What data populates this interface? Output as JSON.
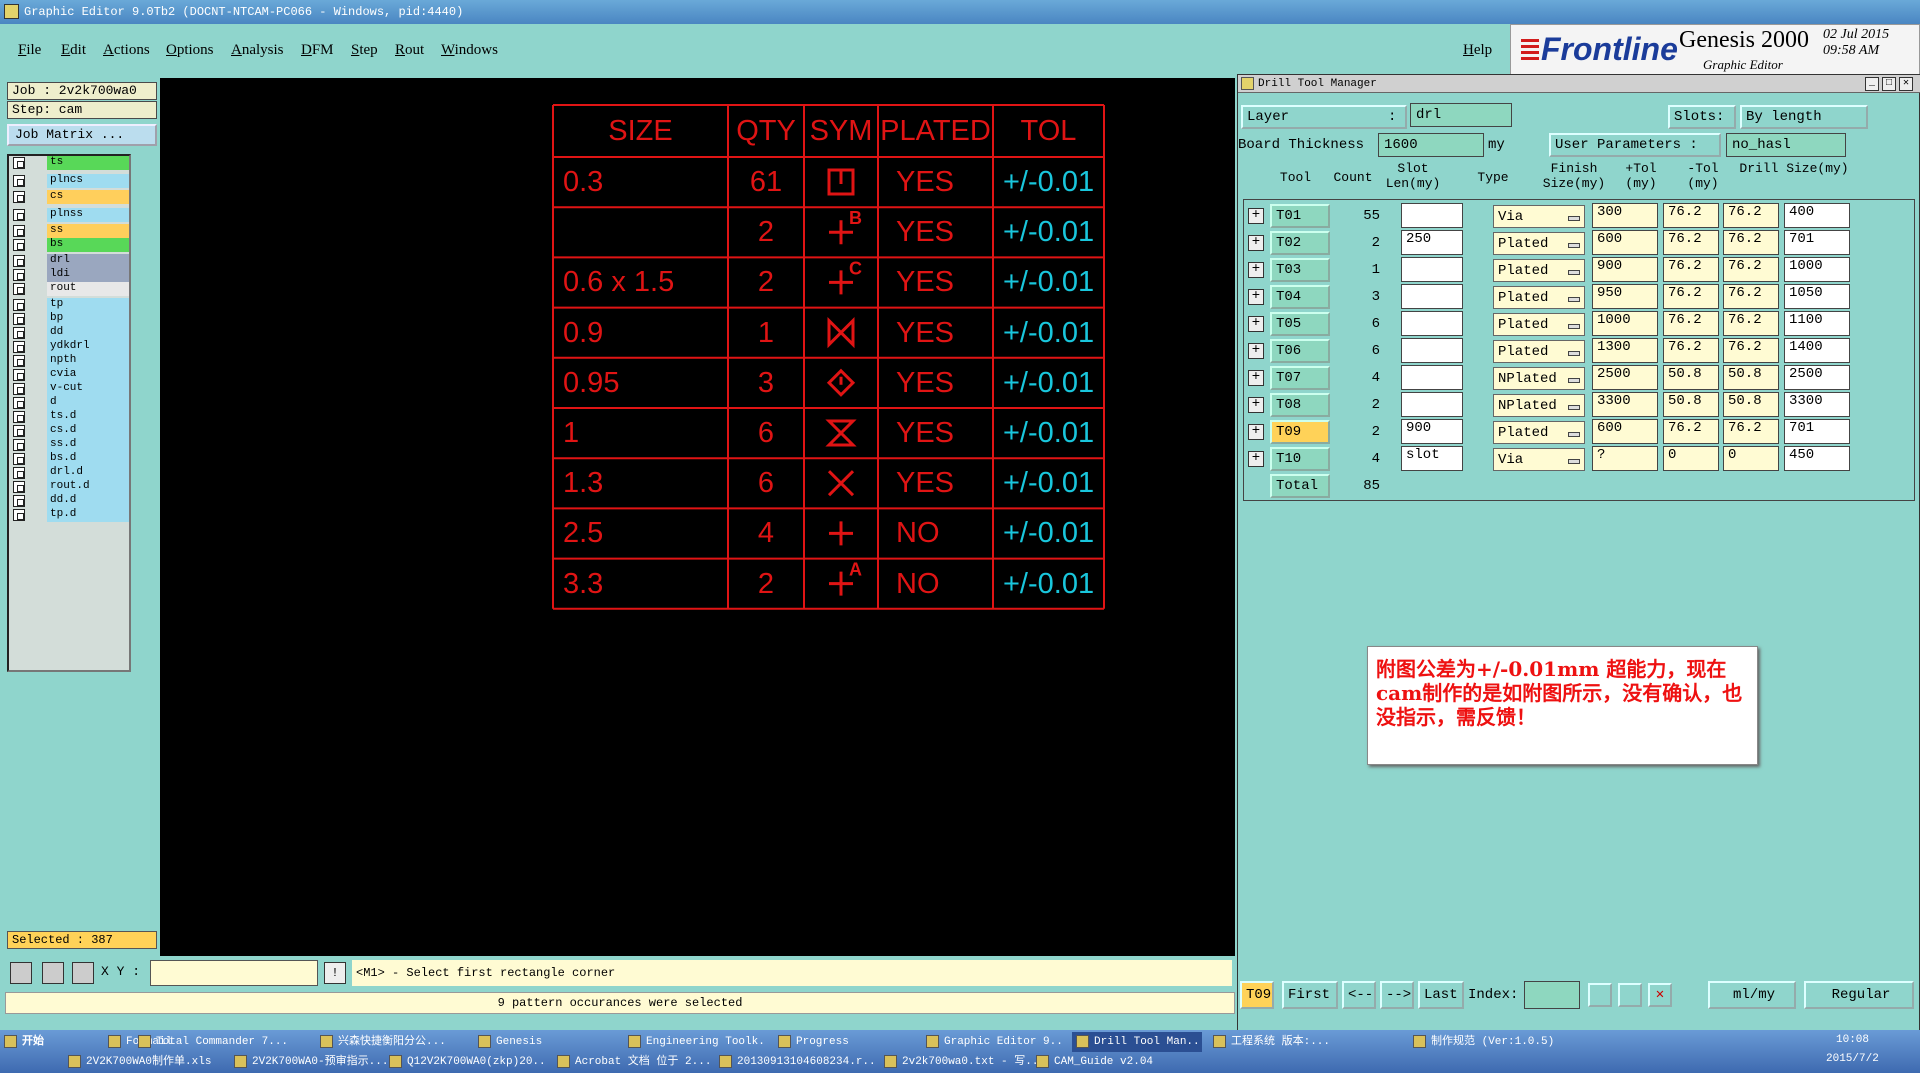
{
  "window": {
    "title": "Graphic Editor 9.0Tb2  (DOCNT-NTCAM-PC066 - Windows, pid:4440)"
  },
  "menu": {
    "items": [
      "File",
      "Edit",
      "Actions",
      "Options",
      "Analysis",
      "DFM",
      "Step",
      "Rout",
      "Windows"
    ],
    "help": "Help"
  },
  "brand": {
    "logo": "Frontline",
    "product": "Genesis 2000",
    "subtitle": "Graphic Editor",
    "date": "02 Jul 2015",
    "time": "09:58 AM"
  },
  "left": {
    "job": "Job  : 2v2k700wa0",
    "step": "Step: cam",
    "job_matrix": "Job Matrix ...",
    "selected": "Selected : 387",
    "layers": [
      {
        "name": "ts",
        "color": "#58d858"
      },
      {
        "name": "plncs",
        "color": "#9fdcf0"
      },
      {
        "name": "cs",
        "color": "#ffcf5c"
      },
      {
        "name": "plnss",
        "color": "#9fdcf0"
      },
      {
        "name": "ss",
        "color": "#ffcf5c"
      },
      {
        "name": "bs",
        "color": "#58d858"
      },
      {
        "name": "drl",
        "color": "#9aa7bf"
      },
      {
        "name": "ldi",
        "color": "#9aa7bf"
      },
      {
        "name": "rout",
        "color": "#e8e8e8"
      },
      {
        "name": "tp",
        "color": "#9fdcf0"
      },
      {
        "name": "bp",
        "color": "#9fdcf0"
      },
      {
        "name": "dd",
        "color": "#9fdcf0"
      },
      {
        "name": "ydkdrl",
        "color": "#9fdcf0"
      },
      {
        "name": "npth",
        "color": "#9fdcf0"
      },
      {
        "name": "cvia",
        "color": "#9fdcf0"
      },
      {
        "name": "v-cut",
        "color": "#9fdcf0"
      },
      {
        "name": "d",
        "color": "#9fdcf0"
      },
      {
        "name": "ts.d",
        "color": "#9fdcf0"
      },
      {
        "name": "cs.d",
        "color": "#9fdcf0"
      },
      {
        "name": "ss.d",
        "color": "#9fdcf0"
      },
      {
        "name": "bs.d",
        "color": "#9fdcf0"
      },
      {
        "name": "drl.d",
        "color": "#9fdcf0"
      },
      {
        "name": "rout.d",
        "color": "#9fdcf0"
      },
      {
        "name": "dd.d",
        "color": "#9fdcf0"
      },
      {
        "name": "tp.d",
        "color": "#9fdcf0"
      }
    ]
  },
  "canvas_table": {
    "headers": [
      "SIZE",
      "QTY",
      "SYM",
      "PLATED",
      "TOL"
    ],
    "rows": [
      {
        "size": "0.3",
        "qty": "61",
        "sym": "box",
        "plated": "YES",
        "tol": "+/-0.01"
      },
      {
        "size": "",
        "qty": "2",
        "sym": "plus-B",
        "plated": "YES",
        "tol": "+/-0.01"
      },
      {
        "size": "0.6 x 1.5",
        "qty": "2",
        "sym": "plus-C",
        "plated": "YES",
        "tol": "+/-0.01"
      },
      {
        "size": "0.9",
        "qty": "1",
        "sym": "bowtie",
        "plated": "YES",
        "tol": "+/-0.01"
      },
      {
        "size": "0.95",
        "qty": "3",
        "sym": "diamond",
        "plated": "YES",
        "tol": "+/-0.01"
      },
      {
        "size": "1",
        "qty": "6",
        "sym": "hourglass",
        "plated": "YES",
        "tol": "+/-0.01"
      },
      {
        "size": "1.3",
        "qty": "6",
        "sym": "x",
        "plated": "YES",
        "tol": "+/-0.01"
      },
      {
        "size": "2.5",
        "qty": "4",
        "sym": "plus",
        "plated": "NO",
        "tol": "+/-0.01"
      },
      {
        "size": "3.3",
        "qty": "2",
        "sym": "plus-A",
        "plated": "NO",
        "tol": "+/-0.01"
      }
    ]
  },
  "cmd": {
    "xy_label": "X Y :",
    "xy_value": "",
    "prompt": "<M1> - Select first rectangle corner",
    "status": "9 pattern occurances were selected"
  },
  "dtm": {
    "title": "Drill Tool Manager",
    "layer_label": "Layer",
    "layer_sep": ":",
    "layer_value": "drl",
    "slots_label": "Slots:",
    "slots_value": "By length",
    "board_thickness_label": "Board Thickness",
    "board_thickness_value": "1600",
    "board_thickness_unit": "my",
    "user_params_label": "User Parameters :",
    "user_params_value": "no_hasl",
    "columns": [
      "Tool",
      "Count",
      "Slot Len(my)",
      "Type",
      "Finish Size(my)",
      "+Tol (my)",
      "-Tol (my)",
      "Drill Size(my)"
    ],
    "rows": [
      {
        "tool": "T01",
        "count": "55",
        "slot": "",
        "type": "Via",
        "finish": "300",
        "ptol": "76.2",
        "mtol": "76.2",
        "drill": "400"
      },
      {
        "tool": "T02",
        "count": "2",
        "slot": "250",
        "type": "Plated",
        "finish": "600",
        "ptol": "76.2",
        "mtol": "76.2",
        "drill": "701"
      },
      {
        "tool": "T03",
        "count": "1",
        "slot": "",
        "type": "Plated",
        "finish": "900",
        "ptol": "76.2",
        "mtol": "76.2",
        "drill": "1000"
      },
      {
        "tool": "T04",
        "count": "3",
        "slot": "",
        "type": "Plated",
        "finish": "950",
        "ptol": "76.2",
        "mtol": "76.2",
        "drill": "1050"
      },
      {
        "tool": "T05",
        "count": "6",
        "slot": "",
        "type": "Plated",
        "finish": "1000",
        "ptol": "76.2",
        "mtol": "76.2",
        "drill": "1100"
      },
      {
        "tool": "T06",
        "count": "6",
        "slot": "",
        "type": "Plated",
        "finish": "1300",
        "ptol": "76.2",
        "mtol": "76.2",
        "drill": "1400"
      },
      {
        "tool": "T07",
        "count": "4",
        "slot": "",
        "type": "NPlated",
        "finish": "2500",
        "ptol": "50.8",
        "mtol": "50.8",
        "drill": "2500"
      },
      {
        "tool": "T08",
        "count": "2",
        "slot": "",
        "type": "NPlated",
        "finish": "3300",
        "ptol": "50.8",
        "mtol": "50.8",
        "drill": "3300"
      },
      {
        "tool": "T09",
        "count": "2",
        "slot": "900",
        "type": "Plated",
        "finish": "600",
        "ptol": "76.2",
        "mtol": "76.2",
        "drill": "701"
      },
      {
        "tool": "T10",
        "count": "4",
        "slot": "slot",
        "type": "Via",
        "finish": "?",
        "ptol": "0",
        "mtol": "0",
        "drill": "450"
      }
    ],
    "total_label": "Total",
    "total_count": "85",
    "current_tool": "T09",
    "first": "First",
    "prev": "<--",
    "next": "-->",
    "last": "Last",
    "index_label": "Index:",
    "index_value": "",
    "units": "ml/my",
    "mode": "Regular"
  },
  "note": {
    "text": "附图公差为+/-0.01mm   超能力，现在cam制作的是如附图所示，没有确认，也没指示，需反馈！"
  },
  "taskbar": {
    "start": "开始",
    "row1": [
      "Foxmail",
      "Total Commander 7...",
      "兴森快捷衡阳分公...",
      "Genesis",
      "Engineering Toolk...",
      "Progress",
      "Graphic Editor 9...",
      "Drill Tool Man...",
      "工程系统  版本:...",
      "制作规范 (Ver:1.0.5)"
    ],
    "row2": [
      "2V2K700WA0制作单.xls",
      "2V2K700WA0-预审指示...",
      "Q12V2K700WA0(zkp)20...",
      "Acrobat 文档 位于 2...",
      "20130913104608234.r...",
      "2v2k700wa0.txt - 写...",
      "CAM_Guide v2.04"
    ],
    "clock_time": "10:08",
    "clock_date": "2015/7/2"
  }
}
